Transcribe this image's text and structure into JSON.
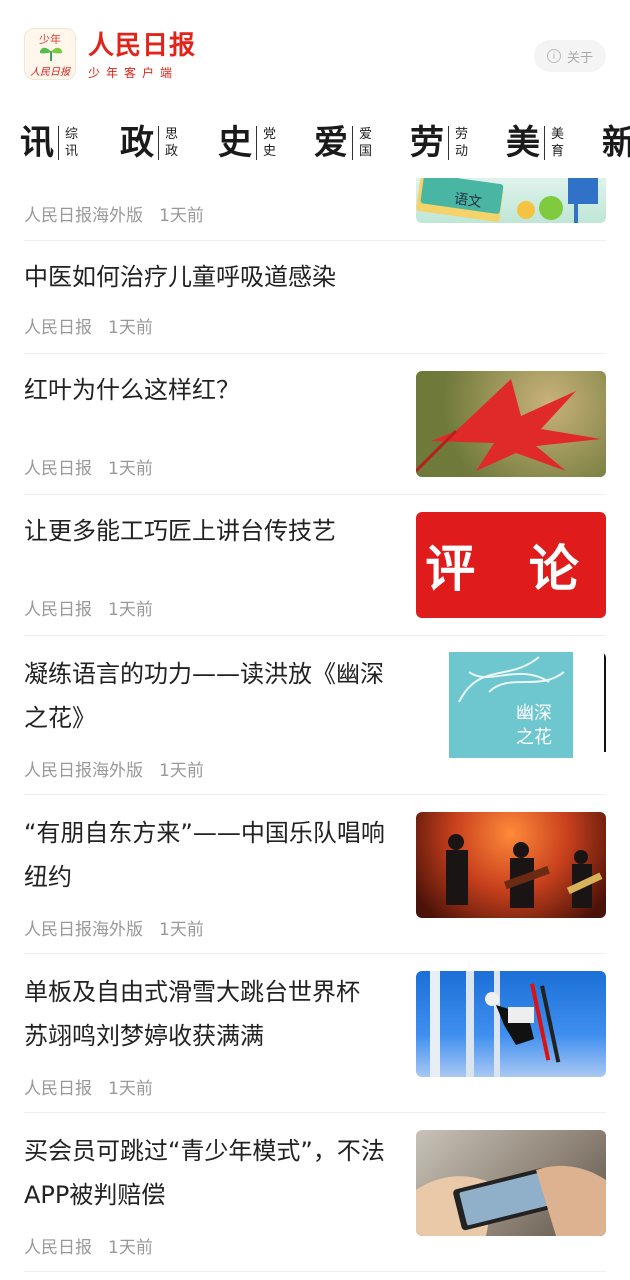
{
  "header": {
    "logo_top": "少年",
    "logo_sig": "人民日报",
    "brand_title": "人民日报",
    "brand_sub": "少年客户端",
    "about_label": "关于",
    "about_icon": "i"
  },
  "categories": [
    {
      "big": "讯",
      "small1": "综",
      "small2": "讯"
    },
    {
      "big": "政",
      "small1": "思",
      "small2": "政"
    },
    {
      "big": "史",
      "small1": "党",
      "small2": "史"
    },
    {
      "big": "爱",
      "small1": "爱",
      "small2": "国"
    },
    {
      "big": "劳",
      "small1": "劳",
      "small2": "动"
    },
    {
      "big": "美",
      "small1": "美",
      "small2": "育"
    },
    {
      "big": "新",
      "small1": "",
      "small2": ""
    }
  ],
  "feed": [
    {
      "title": "",
      "source": "人民日报海外版",
      "time": "1天前",
      "thumb_text": "语文"
    },
    {
      "title": "中医如何治疗儿童呼吸道感染",
      "source": "人民日报",
      "time": "1天前"
    },
    {
      "title": "红叶为什么这样红？",
      "source": "人民日报",
      "time": "1天前"
    },
    {
      "title": "让更多能工巧匠上讲台传技艺",
      "source": "人民日报",
      "time": "1天前",
      "thumb_text": "评 论"
    },
    {
      "title": "凝练语言的功力——读洪放《幽深之花》",
      "title_l1": "凝练语言的功力——读洪放《幽深",
      "title_l2": "之花》",
      "source": "人民日报海外版",
      "time": "1天前",
      "thumb_text": "幽深之花"
    },
    {
      "title": "“有朋自东方来”——中国乐队唱响纽约",
      "title_l1": "“有朋自东方来”——中国乐队唱响",
      "title_l2": "纽约",
      "source": "人民日报海外版",
      "time": "1天前"
    },
    {
      "title": "单板及自由式滑雪大跳台世界杯苏翊鸣刘梦婷收获满满",
      "title_l1": "单板及自由式滑雪大跳台世界杯",
      "title_l2": "苏翊鸣刘梦婷收获满满",
      "source": "人民日报",
      "time": "1天前"
    },
    {
      "title": "买会员可跳过“青少年模式”，不法APP被判赔偿",
      "title_l1": "买会员可跳过“青少年模式”，不法",
      "title_l2": "APP被判赔偿",
      "source": "人民日报",
      "time": "1天前"
    }
  ],
  "colors": {
    "brand_red": "#e2231a",
    "meta_gray": "#999999"
  }
}
